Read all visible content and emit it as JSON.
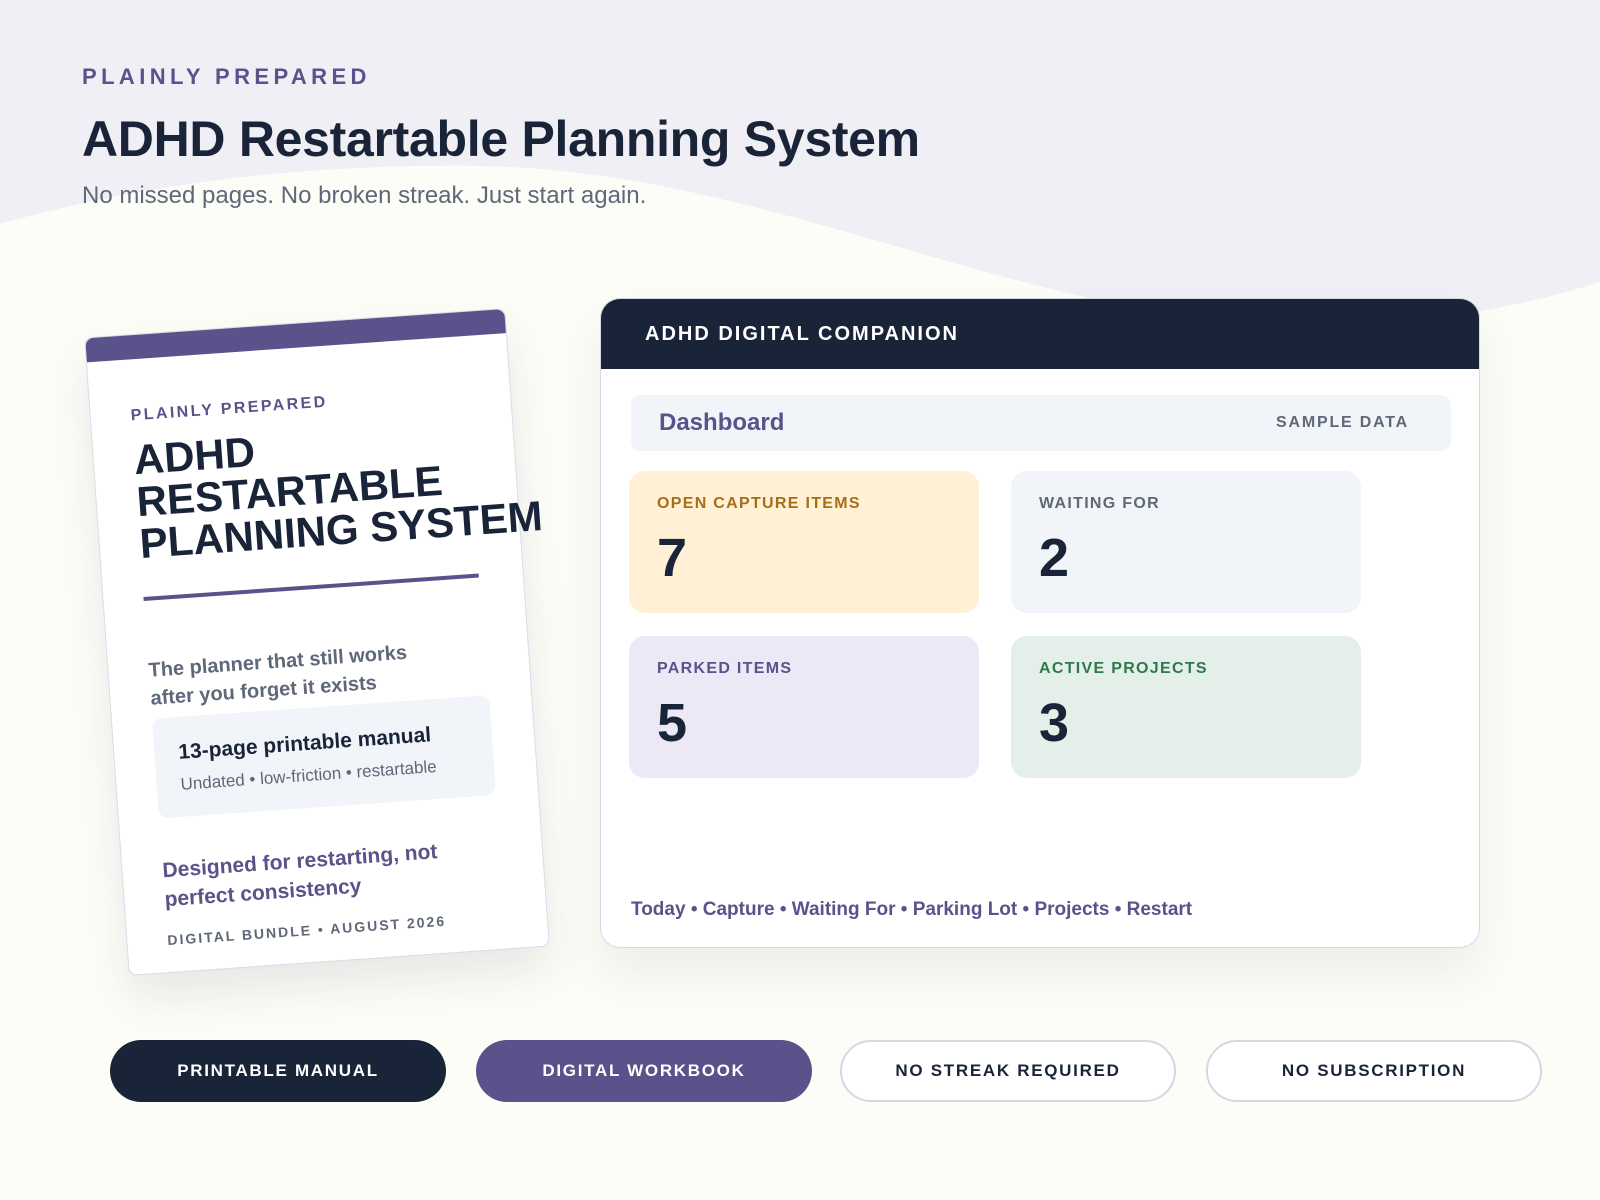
{
  "header": {
    "brand": "PLAINLY PREPARED",
    "title": "ADHD Restartable Planning System",
    "subtitle": "No missed pages. No broken streak. Just start again."
  },
  "cover": {
    "brand": "PLAINLY PREPARED",
    "title_lines": [
      "ADHD",
      "RESTARTABLE",
      "PLANNING SYSTEM"
    ],
    "tagline": "The planner that still works after you forget it exists",
    "box_title": "13-page printable manual",
    "box_subtitle": "Undated • low-friction • restartable",
    "slogan": "Designed for restarting, not perfect consistency",
    "footer": "DIGITAL BUNDLE • AUGUST 2026"
  },
  "companion": {
    "title": "ADHD DIGITAL COMPANION",
    "dashboard_title": "Dashboard",
    "sample_label": "SAMPLE DATA",
    "stats": [
      {
        "label": "OPEN CAPTURE ITEMS",
        "value": "7"
      },
      {
        "label": "WAITING FOR",
        "value": "2"
      },
      {
        "label": "PARKED ITEMS",
        "value": "5"
      },
      {
        "label": "ACTIVE PROJECTS",
        "value": "3"
      }
    ],
    "nav": "Today • Capture • Waiting For • Parking Lot • Projects • Restart"
  },
  "pills": [
    {
      "label": "PRINTABLE MANUAL"
    },
    {
      "label": "DIGITAL WORKBOOK"
    },
    {
      "label": "NO STREAK REQUIRED"
    },
    {
      "label": "NO SUBSCRIPTION"
    }
  ],
  "colors": {
    "navy": "#1a2438",
    "purple": "#5a528a",
    "background": "#fdfdf8",
    "wave": "#f0eff5",
    "capture_bg": "#fff0d6",
    "capture_label": "#a66e17",
    "waiting_bg": "#f1f4f8",
    "parked_bg": "#ece8f5",
    "active_bg": "#e5efe9",
    "active_label": "#2c7a4b"
  }
}
